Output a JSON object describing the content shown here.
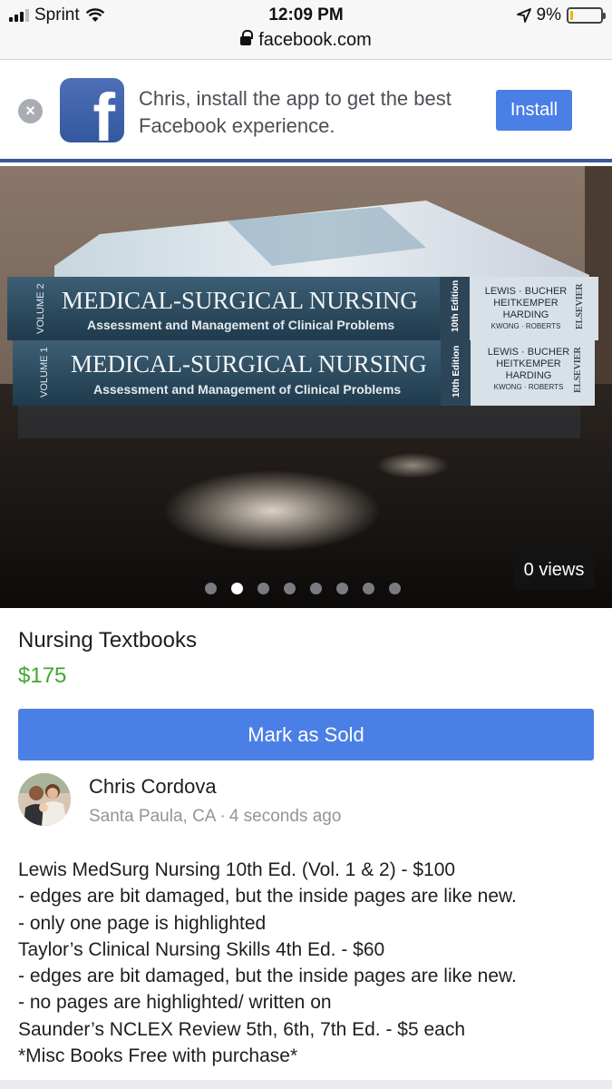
{
  "status_bar": {
    "carrier": "Sprint",
    "time": "12:09 PM",
    "battery": "9%",
    "battery_level": 0.09,
    "url": "facebook.com"
  },
  "banner": {
    "message": "Chris, install the app to get the best Facebook experience.",
    "install_label": "Install",
    "logo_letter": "f"
  },
  "photo": {
    "views": "0 views",
    "slide_count": 8,
    "active_slide": 1
  },
  "listing": {
    "title": "Nursing Textbooks",
    "price": "$175",
    "mark_sold_label": "Mark as Sold"
  },
  "seller": {
    "name": "Chris Cordova",
    "location": "Santa Paula, CA",
    "separator": "·",
    "posted": "4 seconds ago"
  },
  "description": [
    "Lewis MedSurg Nursing 10th Ed. (Vol. 1 & 2) - $100",
    "- edges are bit damaged, but the inside pages are like new.",
    "- only one page is highlighted",
    "Taylor’s Clinical Nursing Skills 4th Ed. - $60",
    "- edges are bit damaged, but the inside pages are like new.",
    "- no pages are highlighted/ written on",
    "Saunder’s NCLEX Review 5th, 6th, 7th Ed. - $5 each",
    "*Misc Books Free with purchase*"
  ],
  "book_spines": [
    {
      "volume": "VOLUME 2",
      "title": "MEDICAL-SURGICAL NURSING",
      "subtitle": "Assessment and Management of Clinical Problems",
      "edition": "10th Edition",
      "authors_1": "LEWIS · BUCHER",
      "authors_2": "HEITKEMPER",
      "authors_3": "HARDING",
      "authors_4": "KWONG · ROBERTS",
      "publisher": "ELSEVIER"
    },
    {
      "volume": "VOLUME 1",
      "title": "MEDICAL-SURGICAL NURSING",
      "subtitle": "Assessment and Management of Clinical Problems",
      "edition": "10th Edition",
      "authors_1": "LEWIS · BUCHER",
      "authors_2": "HEITKEMPER",
      "authors_3": "HARDING",
      "authors_4": "KWONG · ROBERTS",
      "publisher": "ELSEVIER"
    }
  ],
  "colors": {
    "facebook_blue": "#3b5998",
    "button_blue": "#4a7fe6",
    "price_green": "#42a52e",
    "meta_gray": "#90949c"
  }
}
